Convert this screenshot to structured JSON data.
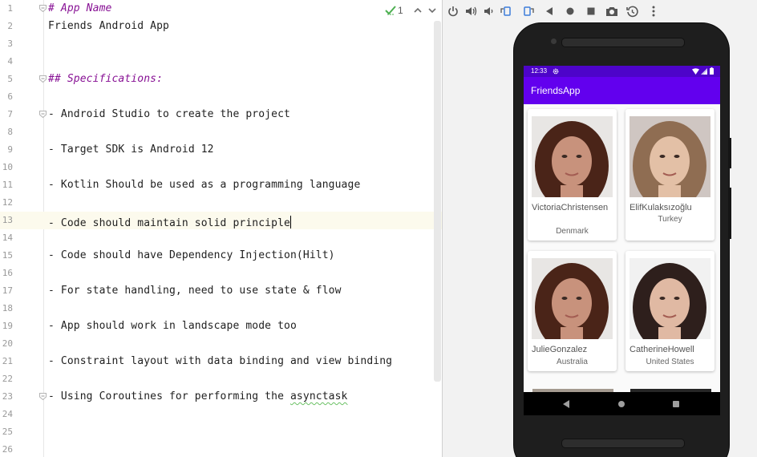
{
  "editor": {
    "lines": [
      {
        "n": "1",
        "text": "# App Name",
        "kind": "heading"
      },
      {
        "n": "2",
        "text": "Friends Android App",
        "kind": "plain"
      },
      {
        "n": "3",
        "text": "",
        "kind": "plain"
      },
      {
        "n": "4",
        "text": "",
        "kind": "plain"
      },
      {
        "n": "5",
        "text": "## Specifications:",
        "kind": "heading"
      },
      {
        "n": "6",
        "text": "",
        "kind": "plain"
      },
      {
        "n": "7",
        "text": "- Android Studio to create the project",
        "kind": "plain"
      },
      {
        "n": "8",
        "text": "",
        "kind": "plain"
      },
      {
        "n": "9",
        "text": "- Target SDK is Android 12",
        "kind": "plain"
      },
      {
        "n": "10",
        "text": "",
        "kind": "plain"
      },
      {
        "n": "11",
        "text": "- Kotlin Should be used as a programming language",
        "kind": "plain"
      },
      {
        "n": "12",
        "text": "",
        "kind": "plain"
      },
      {
        "n": "13",
        "text": "- Code should maintain solid principle",
        "kind": "plain"
      },
      {
        "n": "14",
        "text": "",
        "kind": "plain"
      },
      {
        "n": "15",
        "text": "- Code should have Dependency Injection(Hilt)",
        "kind": "plain"
      },
      {
        "n": "16",
        "text": "",
        "kind": "plain"
      },
      {
        "n": "17",
        "text": "- For state handling, need to use state & flow",
        "kind": "plain"
      },
      {
        "n": "18",
        "text": "",
        "kind": "plain"
      },
      {
        "n": "19",
        "text": "- App should work in landscape mode too",
        "kind": "plain"
      },
      {
        "n": "20",
        "text": "",
        "kind": "plain"
      },
      {
        "n": "21",
        "text": "- Constraint layout with data binding and view binding",
        "kind": "plain"
      },
      {
        "n": "22",
        "text": "",
        "kind": "plain"
      },
      {
        "n": "23",
        "text": "- Using Coroutines for performing the asynctask",
        "kind": "plain"
      },
      {
        "n": "24",
        "text": "",
        "kind": "plain"
      },
      {
        "n": "25",
        "text": "",
        "kind": "plain"
      },
      {
        "n": "26",
        "text": "",
        "kind": "plain"
      }
    ],
    "current_line": "13",
    "fold_marker_lines": [
      "1",
      "5",
      "7",
      "23"
    ],
    "squiggle_word": "asynctask",
    "inspection_count": "1"
  },
  "emulator": {
    "toolbar_icons": [
      "power-icon",
      "volume-up-icon",
      "volume-down-icon",
      "rotate-left-icon",
      "rotate-right-icon",
      "back-icon",
      "home-icon",
      "overview-icon",
      "camera-icon",
      "snapshot-icon",
      "more-icon"
    ],
    "status_time": "12:33",
    "app_title": "FriendsApp",
    "friends": [
      {
        "name": "VictoriaChristensen",
        "country": "Denmark",
        "hair": "#4a2418",
        "skin": "#c8927c",
        "bg": "#e8e6e4"
      },
      {
        "name": "ElifKulaksızoğlu",
        "country": "Turkey",
        "hair": "#8f6d52",
        "skin": "#e3c0a6",
        "bg": "#cfc6c2"
      },
      {
        "name": "JulieGonzalez",
        "country": "Australia",
        "hair": "#4a2418",
        "skin": "#c8927c",
        "bg": "#e8e6e4"
      },
      {
        "name": "CatherineHowell",
        "country": "United States",
        "hair": "#2e1f1c",
        "skin": "#e0b9a3",
        "bg": "#f1f1f1"
      }
    ]
  },
  "colors": {
    "app_bar": "#6200ee",
    "status_bar": "#4d04c9",
    "heading_text": "#871094",
    "current_line": "#fcfaed"
  }
}
